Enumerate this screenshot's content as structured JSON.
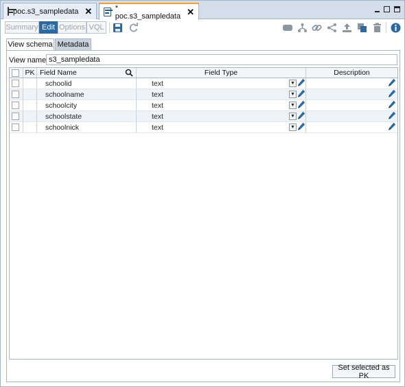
{
  "editor_tabs": [
    {
      "label": "poc.s3_sampledata",
      "active": false
    },
    {
      "label": "* poc.s3_sampledata",
      "active": true
    }
  ],
  "toolbar": {
    "modes": [
      "Summary",
      "Edit",
      "Options",
      "VQL"
    ],
    "active_mode": "Edit",
    "icons": [
      "save-icon",
      "refresh-icon",
      "cloud-icon",
      "tree-icon",
      "link-icon",
      "share-icon",
      "upload-icon",
      "copy-icon",
      "trash-icon",
      "info-icon"
    ]
  },
  "inner_tabs": [
    "View schema",
    "Metadata"
  ],
  "view_name": {
    "label": "View name:",
    "value": "s3_sampledata"
  },
  "grid": {
    "headers": {
      "pk": "PK",
      "field_name": "Field Name",
      "field_type": "Field Type",
      "description": "Description"
    },
    "rows": [
      {
        "name": "schoolid",
        "type": "text",
        "description": ""
      },
      {
        "name": "schoolname",
        "type": "text",
        "description": ""
      },
      {
        "name": "schoolcity",
        "type": "text",
        "description": ""
      },
      {
        "name": "schoolstate",
        "type": "text",
        "description": ""
      },
      {
        "name": "schoolnick",
        "type": "text",
        "description": ""
      }
    ]
  },
  "actions": {
    "set_pk": "Set selected as PK"
  },
  "colors": {
    "accent": "#2a6aa4",
    "tab_highlight": "#f0a030",
    "frame": "#9fb4c8"
  }
}
